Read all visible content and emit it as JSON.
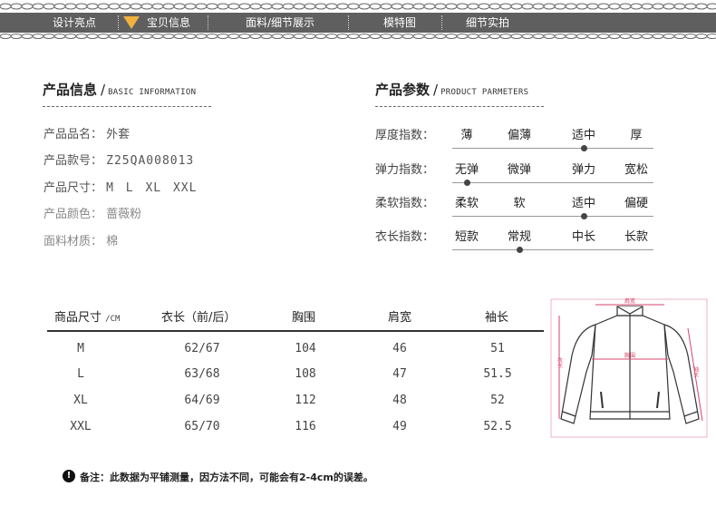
{
  "nav": {
    "items": [
      "设计亮点",
      "宝贝信息",
      "面料/细节展示",
      "模特图",
      "细节实拍"
    ],
    "accent_color": "#f0b13f",
    "bar_color": "#5f5f5f"
  },
  "product_info": {
    "title_cn": "产品信息",
    "title_en": "BASIC INFORMATION",
    "name_label": "产品品名：",
    "name_value": "外套",
    "code_label": "产品款号：",
    "code_value": "Z25QA008013",
    "size_label": "产品尺寸：",
    "size_value": "M L XL XXL",
    "color_label": "产品颜色：",
    "color_value": "蔷薇粉",
    "fabric_label": "面料材质：",
    "fabric_value": "棉"
  },
  "product_params": {
    "title_cn": "产品参数",
    "title_en": "PRODUCT PARMETERS",
    "rows": [
      {
        "label": "厚度指数：",
        "options": [
          "薄",
          "偏薄",
          "适中",
          "厚"
        ],
        "selected_index": 2
      },
      {
        "label": "弹力指数：",
        "options": [
          "无弹",
          "微弹",
          "弹力",
          "宽松"
        ],
        "selected_index": 0
      },
      {
        "label": "柔软指数：",
        "options": [
          "柔软",
          "软",
          "适中",
          "偏硬"
        ],
        "selected_index": 2
      },
      {
        "label": "衣长指数：",
        "options": [
          "短款",
          "常规",
          "中长",
          "长款"
        ],
        "selected_index": 1
      }
    ]
  },
  "size_table": {
    "header_title": "商品尺寸",
    "header_unit": "/CM",
    "columns": [
      "衣长（前/后）",
      "胸围",
      "肩宽",
      "袖长"
    ],
    "rows": [
      {
        "size": "M",
        "length": "62/67",
        "chest": "104",
        "shoulder": "46",
        "sleeve": "51"
      },
      {
        "size": "L",
        "length": "63/68",
        "chest": "108",
        "shoulder": "47",
        "sleeve": "51.5"
      },
      {
        "size": "XL",
        "length": "64/69",
        "chest": "112",
        "shoulder": "48",
        "sleeve": "52"
      },
      {
        "size": "XXL",
        "length": "65/70",
        "chest": "116",
        "shoulder": "49",
        "sleeve": "52.5"
      }
    ]
  },
  "diagram": {
    "shoulder_label": "肩宽",
    "chest_label": "胸围",
    "length_label": "衣长",
    "sleeve_label": "袖长",
    "measure_color": "#d9436b"
  },
  "note": {
    "icon": "exclamation-icon",
    "text": "备注：此数据为平铺测量，因方法不同，可能会有2-4cm的误差。"
  }
}
